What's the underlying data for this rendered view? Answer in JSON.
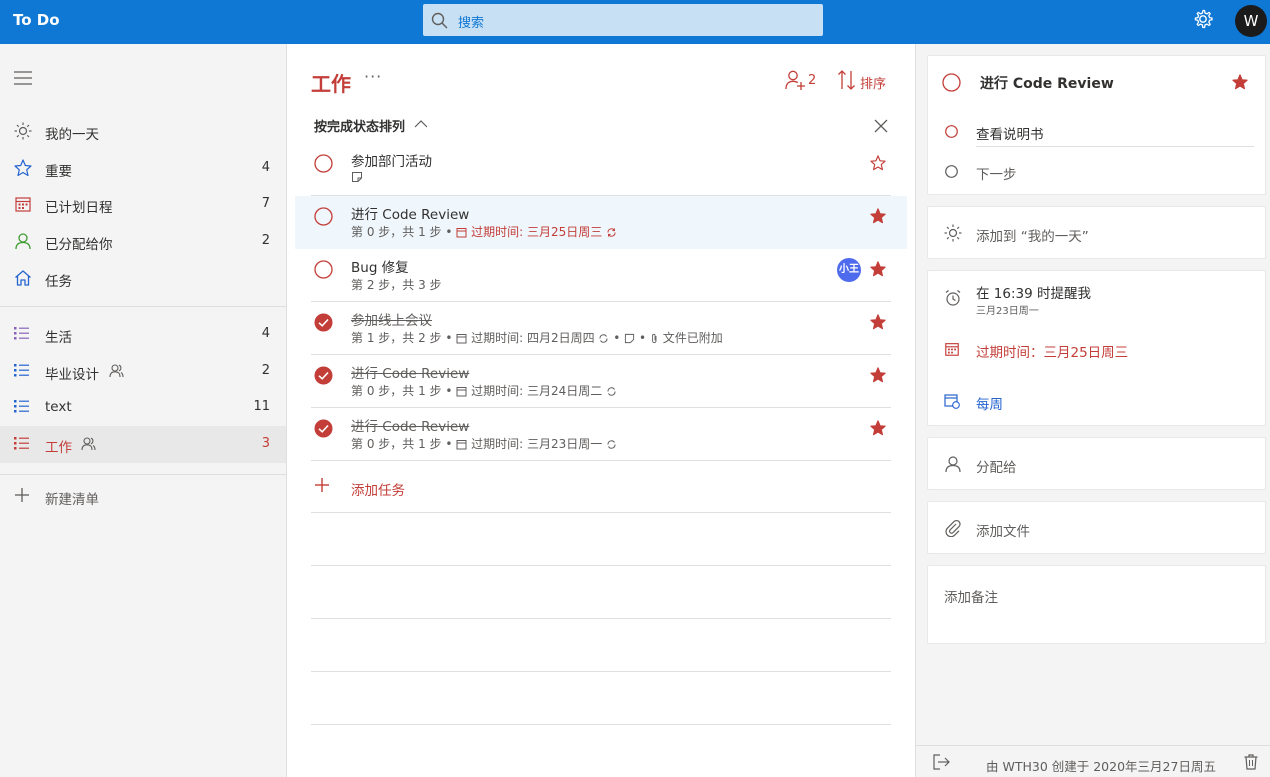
{
  "app": {
    "title": "To Do",
    "avatar_initial": "W"
  },
  "search": {
    "placeholder": "搜索"
  },
  "colors": {
    "accent": "#c33e39",
    "header": "#0f78d4",
    "blue": "#2564cf",
    "green": "#3f9c35"
  },
  "sidebar": {
    "menu_icon": "hamburger-icon",
    "smart_lists": [
      {
        "label": "我的一天",
        "count": "",
        "icon": "sun-icon"
      },
      {
        "label": "重要",
        "count": "4",
        "icon": "star-icon"
      },
      {
        "label": "已计划日程",
        "count": "7",
        "icon": "calendar-icon"
      },
      {
        "label": "已分配给你",
        "count": "2",
        "icon": "person-icon"
      },
      {
        "label": "任务",
        "count": "",
        "icon": "home-icon"
      }
    ],
    "lists": [
      {
        "label": "生活",
        "count": "4",
        "shared": false
      },
      {
        "label": "毕业设计",
        "count": "2",
        "shared": true
      },
      {
        "label": "text",
        "count": "11",
        "shared": false
      },
      {
        "label": "工作",
        "count": "3",
        "shared": true,
        "active": true
      }
    ],
    "new_list_label": "新建清单"
  },
  "list": {
    "title": "工作",
    "more": "···",
    "share_count": "2",
    "sort_label": "排序",
    "group_label": "按完成状态排列",
    "add_task_label": "添加任务",
    "tasks": [
      {
        "title": "参加部门活动",
        "meta": "",
        "done": false,
        "starred": false,
        "has_note": true
      },
      {
        "title": "进行 Code Review",
        "steps": "第 0 步，共 1 步",
        "due": "过期时间: 三月25日周三",
        "done": false,
        "starred": true,
        "selected": true
      },
      {
        "title": "Bug 修复",
        "steps": "第 2 步，共 3 步",
        "done": false,
        "starred": true,
        "assignee": "小王"
      },
      {
        "title": "参加线上会议",
        "steps": "第 1 步，共 2 步",
        "due": "过期时间: 四月2日周四",
        "files": "文件已附加",
        "done": true,
        "starred": true
      },
      {
        "title": "进行 Code Review",
        "steps": "第 0 步，共 1 步",
        "due": "过期时间: 三月24日周二",
        "done": true,
        "starred": true
      },
      {
        "title": "进行 Code Review",
        "steps": "第 0 步，共 1 步",
        "due": "过期时间: 三月23日周一",
        "done": true,
        "starred": true
      }
    ]
  },
  "detail": {
    "title": "进行 Code Review",
    "steps": [
      "查看说明书"
    ],
    "next_step_placeholder": "下一步",
    "add_my_day": "添加到 “我的一天”",
    "reminder": "在 16:39 时提醒我",
    "reminder_date": "三月23日周一",
    "due": "过期时间：三月25日周三",
    "repeat": "每周",
    "assign": "分配给",
    "add_file": "添加文件",
    "note_placeholder": "添加备注",
    "footer": "由 WTH30 创建于 2020年三月27日周五"
  }
}
